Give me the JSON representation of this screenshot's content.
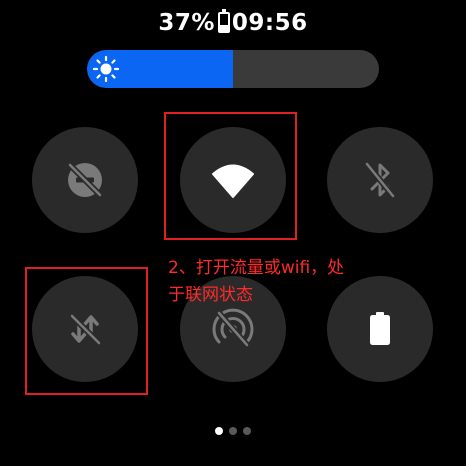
{
  "status_bar": {
    "battery_percent": "37%",
    "time": "09:56",
    "battery_level": 0.37
  },
  "brightness": {
    "level": 0.5,
    "icon": "sun-icon"
  },
  "tiles": [
    {
      "name": "do-not-disturb",
      "icon": "do-not-disturb-off-icon",
      "state": "off"
    },
    {
      "name": "wifi",
      "icon": "wifi-icon",
      "state": "on"
    },
    {
      "name": "bluetooth",
      "icon": "bluetooth-off-icon",
      "state": "off"
    },
    {
      "name": "mobile-data",
      "icon": "mobile-data-off-icon",
      "state": "off"
    },
    {
      "name": "nfc",
      "icon": "nfc-off-icon",
      "state": "off"
    },
    {
      "name": "battery",
      "icon": "battery-icon",
      "state": "info"
    }
  ],
  "annotation": {
    "text": "2、打开流量或wifi，处\n于联网状态",
    "color": "#ff2a2a"
  },
  "page_indicator": {
    "count": 3,
    "active": 1
  },
  "colors": {
    "accent": "#0a66f3",
    "tile_bg": "#2a2a2a",
    "highlight": "#e02020"
  }
}
